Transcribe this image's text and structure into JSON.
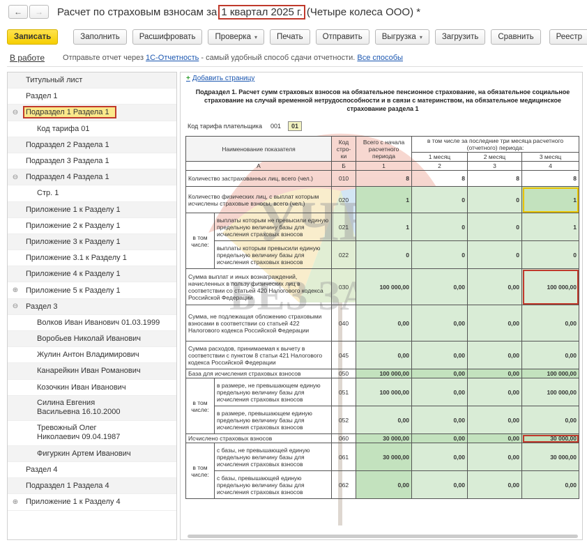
{
  "window": {
    "title_prefix": "Расчет по страховым взносам за",
    "title_period": "1 квартал 2025 г.",
    "title_suffix": "(Четыре колеса ООО) *",
    "back_glyph": "←",
    "forward_glyph": "→"
  },
  "toolbar": {
    "save": "Записать",
    "fill": "Заполнить",
    "decode": "Расшифровать",
    "check": "Проверка",
    "print": "Печать",
    "send": "Отправить",
    "export": "Выгрузка",
    "load": "Загрузить",
    "compare": "Сравнить",
    "registry": "Реестр",
    "attach_icon": "paperclip-icon",
    "dropdown_glyph": "▾"
  },
  "status": {
    "state": "В работе",
    "info_prefix": "Отправьте отчет через",
    "link_service": "1С-Отчетность",
    "info_middle": "- самый удобный способ сдачи отчетности.",
    "link_all": "Все способы"
  },
  "sidebar": {
    "items": [
      {
        "label": "Титульный лист"
      },
      {
        "label": "Раздел 1"
      },
      {
        "label": "Подраздел 1 Раздела 1",
        "expander": "⊖",
        "selected": true
      },
      {
        "label": "Код тарифа 01",
        "level": 2
      },
      {
        "label": "Подраздел 2 Раздела 1"
      },
      {
        "label": "Подраздел 3 Раздела 1"
      },
      {
        "label": "Подраздел 4 Раздела 1",
        "expander": "⊖"
      },
      {
        "label": "Стр. 1",
        "level": 2
      },
      {
        "label": "Приложение 1 к Разделу 1"
      },
      {
        "label": "Приложение 2 к Разделу 1"
      },
      {
        "label": "Приложение 3 к Разделу 1"
      },
      {
        "label": "Приложение 3.1 к Разделу 1"
      },
      {
        "label": "Приложение 4 к Разделу 1"
      },
      {
        "label": "Приложение 5 к Разделу 1",
        "expander": "⊕"
      },
      {
        "label": "Раздел 3",
        "expander": "⊖"
      },
      {
        "label": "Волков Иван Иванович 01.03.1999",
        "level": 2
      },
      {
        "label": "Воробьев Николай Иванович",
        "level": 2
      },
      {
        "label": "Жулин Антон Владимирович",
        "level": 2
      },
      {
        "label": "Канарейкин Иван Романович",
        "level": 2
      },
      {
        "label": "Козочкин Иван Иванович",
        "level": 2
      },
      {
        "label": "Силина Евгения Васильевна 16.10.2000",
        "level": 2,
        "tall": true
      },
      {
        "label": "Тревожный Олег Николаевич 09.04.1987",
        "level": 2,
        "tall": true
      },
      {
        "label": "Фигуркин Артем Иванович",
        "level": 2
      },
      {
        "label": "Раздел 4"
      },
      {
        "label": "Подраздел 1 Раздела 4"
      },
      {
        "label": "Приложение 1 к Разделу 4",
        "expander": "⊕"
      }
    ]
  },
  "form": {
    "add_page": "Добавить страницу",
    "add_icon": "plus-icon",
    "heading": "Подраздел 1. Расчет сумм страховых взносов на обязательное пенсионное страхование, на обязательное социальное страхование на случай временной нетрудоспособности и в связи с материнством, на обязательное медицинское страхование раздела 1",
    "tariff_label": "Код тарифа плательщика",
    "tariff_code": "001",
    "tariff_value": "01",
    "col_name": "Наименование показателя",
    "col_code": "Код стро-ки",
    "col_total": "Всего с начала расчетного периода",
    "col_last3": "в том числе за последние три месяца расчетного (отчетного) периода:",
    "col_m1": "1 месяц",
    "col_m2": "2 месяц",
    "col_m3": "3 месяц",
    "letters": [
      "А",
      "Б",
      "1",
      "2",
      "3",
      "4"
    ],
    "in_that": "в том числе:",
    "rows": [
      {
        "name": "Количество застрахованных лиц, всего (чел.)",
        "code": "010",
        "v": [
          "8",
          "8",
          "8",
          "8"
        ]
      },
      {
        "name": "Количество физических лиц, с выплат которым исчислены страховые взносы, всего (чел.)",
        "code": "020",
        "v": [
          "1",
          "0",
          "0",
          "1"
        ]
      },
      {
        "name": "выплаты которым не превысили единую предельную величину базы для исчисления страховых взносов",
        "code": "021",
        "v": [
          "1",
          "0",
          "0",
          "1"
        ]
      },
      {
        "name": "выплаты которым превысили единую предельную величину базы для исчисления страховых взносов",
        "code": "022",
        "v": [
          "0",
          "0",
          "0",
          "0"
        ]
      },
      {
        "name": "Сумма выплат и иных вознаграждений, начисленных в пользу физических лиц в соответствии со статьей 420 Налогового кодекса Российской Федерации",
        "code": "030",
        "v": [
          "100 000,00",
          "0,00",
          "0,00",
          "100 000,00"
        ]
      },
      {
        "name": "Сумма, не подлежащая обложению страховыми взносами в соответствии со статьей 422 Налогового кодекса Российской Федерации",
        "code": "040",
        "v": [
          "0,00",
          "0,00",
          "0,00",
          "0,00"
        ]
      },
      {
        "name": "Сумма расходов, принимаемая к вычету в соответствии с пунктом 8 статьи 421 Налогового кодекса Российской Федерации",
        "code": "045",
        "v": [
          "0,00",
          "0,00",
          "0,00",
          "0,00"
        ]
      },
      {
        "name": "База для исчисления страховых взносов",
        "code": "050",
        "v": [
          "100 000,00",
          "0,00",
          "0,00",
          "100 000,00"
        ]
      },
      {
        "name": "в размере, не превышающем единую предельную величину базы для исчисления страховых взносов",
        "code": "051",
        "v": [
          "100 000,00",
          "0,00",
          "0,00",
          "100 000,00"
        ]
      },
      {
        "name": "в размере, превышающем единую предельную величину базы для исчисления страховых взносов",
        "code": "052",
        "v": [
          "0,00",
          "0,00",
          "0,00",
          "0,00"
        ]
      },
      {
        "name": "Исчислено страховых взносов",
        "code": "060",
        "v": [
          "30 000,00",
          "0,00",
          "0,00",
          "30 000,00"
        ]
      },
      {
        "name": "с базы, не превышающей единую предельную величину базы для исчисления страховых взносов",
        "code": "061",
        "v": [
          "30 000,00",
          "0,00",
          "0,00",
          "30 000,00"
        ]
      },
      {
        "name": "с базы, превышающей единую предельную величину базы для исчисления страховых взносов",
        "code": "062",
        "v": [
          "0,00",
          "0,00",
          "0,00",
          "0,00"
        ]
      }
    ]
  },
  "watermark": {
    "line1": "УЧЕТ",
    "line2": "БЕЗ ЗАБОТ"
  }
}
